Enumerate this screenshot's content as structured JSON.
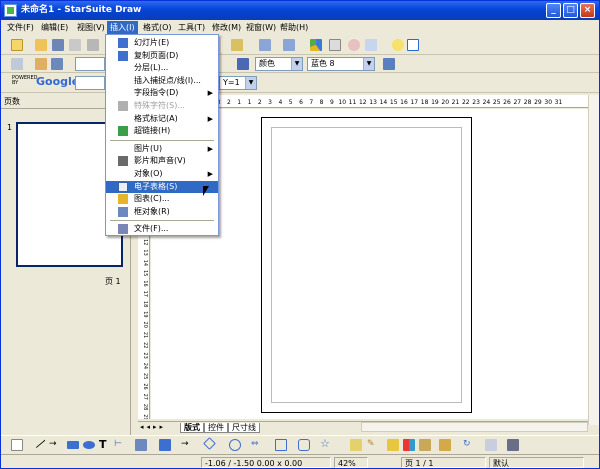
{
  "window": {
    "title": "未命名1 - StarSuite Draw",
    "buttons": [
      "_",
      "□",
      "×"
    ]
  },
  "menu": [
    {
      "label": "文件(F)"
    },
    {
      "label": "编辑(E)"
    },
    {
      "label": "视图(V)"
    },
    {
      "label": "插入(I)"
    },
    {
      "label": "格式(O)"
    },
    {
      "label": "工具(T)"
    },
    {
      "label": "修改(M)"
    },
    {
      "label": "视窗(W)"
    },
    {
      "label": "帮助(H)"
    }
  ],
  "toolbar": {
    "line_color_label": "颜色",
    "area_color_label": "蓝色 8",
    "google_label": "Google",
    "google_prefix": "POWERED BY",
    "zoom_value": "Y=1"
  },
  "insert_menu": {
    "items": [
      {
        "label": "幻灯片(E)",
        "icon": "slide-icon",
        "disabled": false,
        "submenu": false
      },
      {
        "label": "复制页面(D)",
        "icon": "duplicate-page-icon",
        "disabled": false,
        "submenu": false
      },
      {
        "label": "分层(L)...",
        "icon": "",
        "disabled": false,
        "submenu": false
      },
      {
        "label": "插入捕捉点/线(I)...",
        "icon": "",
        "disabled": false,
        "submenu": false
      },
      {
        "label": "字段指令(D)",
        "icon": "",
        "disabled": false,
        "submenu": true
      },
      {
        "label": "特殊字符(S)...",
        "icon": "special-char-icon",
        "disabled": true,
        "submenu": false
      },
      {
        "label": "格式标记(A)",
        "icon": "",
        "disabled": false,
        "submenu": true
      },
      {
        "label": "超链接(H)",
        "icon": "hyperlink-icon",
        "disabled": false,
        "submenu": false
      },
      {
        "label": "图片(U)",
        "icon": "",
        "disabled": false,
        "submenu": true
      },
      {
        "label": "影片和声音(V)",
        "icon": "movie-sound-icon",
        "disabled": false,
        "submenu": false
      },
      {
        "label": "对象(O)",
        "icon": "",
        "disabled": false,
        "submenu": true
      },
      {
        "label": "电子表格(S)",
        "icon": "spreadsheet-icon",
        "disabled": false,
        "submenu": false,
        "highlighted": true
      },
      {
        "label": "图表(C)...",
        "icon": "chart-icon",
        "disabled": false,
        "submenu": false
      },
      {
        "label": "框对象(R)",
        "icon": "frame-icon",
        "disabled": false,
        "submenu": false
      },
      {
        "label": "文件(F)...",
        "icon": "file-icon",
        "disabled": false,
        "submenu": false
      }
    ]
  },
  "sidebar": {
    "title": "页数",
    "close": "×",
    "page_number": "1",
    "page_label": "页 1"
  },
  "ruler": {
    "h_ticks": [
      "5",
      "4",
      "3",
      "2",
      "1",
      "1",
      "2",
      "3",
      "4",
      "5",
      "6",
      "7",
      "8",
      "9",
      "10",
      "11",
      "12",
      "13",
      "14",
      "15",
      "16",
      "17",
      "18",
      "19",
      "20",
      "21",
      "22",
      "23",
      "24",
      "25",
      "26",
      "27",
      "28",
      "29",
      "30",
      "31"
    ],
    "v_ticks": [
      "1",
      "2",
      "3",
      "4",
      "5",
      "6",
      "7",
      "8",
      "9",
      "10",
      "11",
      "12",
      "13",
      "14",
      "15",
      "16",
      "17",
      "18",
      "19",
      "20",
      "21",
      "22",
      "23",
      "24",
      "25",
      "26",
      "27",
      "28",
      "29"
    ]
  },
  "tabs": [
    {
      "label": "版式"
    },
    {
      "label": "控件"
    },
    {
      "label": "尺寸线"
    }
  ],
  "status": {
    "position": "-1.06 / -1.50",
    "size": "0.00 x 0.00",
    "zoom": "42%",
    "page": "页 1 / 1",
    "layout": "默认"
  },
  "colors": {
    "title_bar": "#0a46d8",
    "highlight": "#316ac5",
    "workspace": "#ece9d8"
  }
}
